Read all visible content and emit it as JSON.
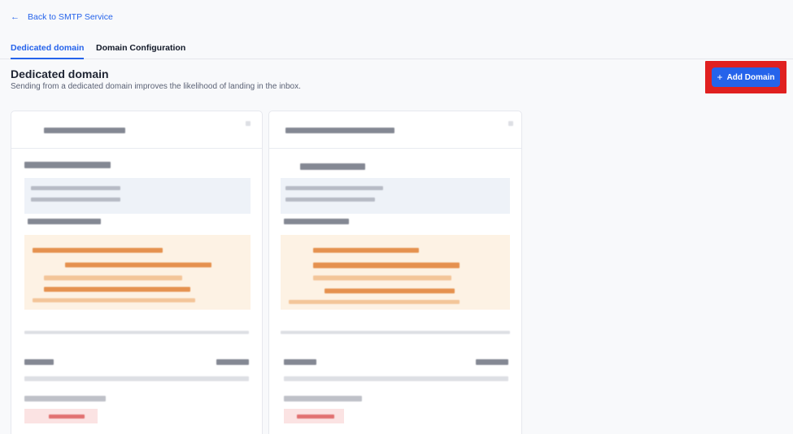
{
  "nav": {
    "back_label": "Back to SMTP Service",
    "back_icon": "arrow-left-icon"
  },
  "tabs": [
    {
      "label": "Dedicated domain",
      "active": true
    },
    {
      "label": "Domain Configuration",
      "active": false
    }
  ],
  "section": {
    "title": "Dedicated domain",
    "subtitle": "Sending from a dedicated domain improves the likelihood of landing in the inbox."
  },
  "actions": {
    "add_label": "Add Domain",
    "add_icon": "plus-icon"
  },
  "colors": {
    "accent": "#2563eb",
    "highlight": "#e02020"
  }
}
